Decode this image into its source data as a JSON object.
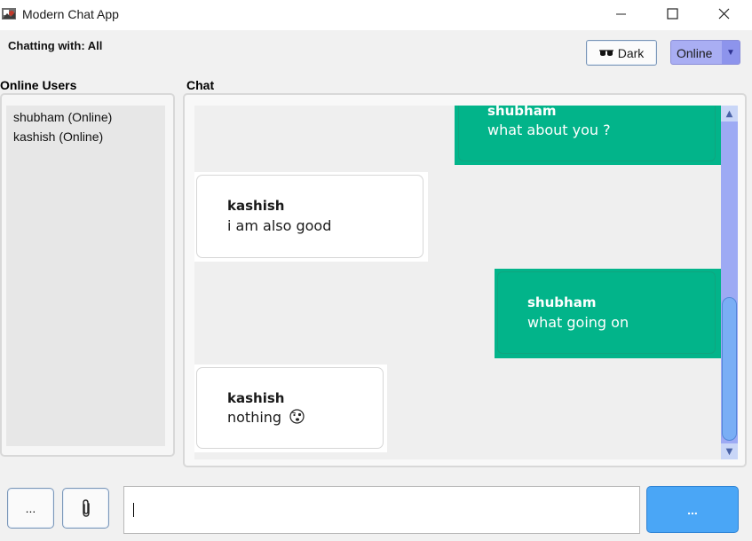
{
  "window": {
    "title": "Modern Chat App",
    "controls": {
      "minimize": "—",
      "maximize": "☐",
      "close": "✕"
    }
  },
  "header": {
    "chatting_with": "Chatting with: All",
    "theme_button": "Dark",
    "theme_icon": "sunglasses-icon",
    "status_select": {
      "value": "Online",
      "arrow": "▼"
    }
  },
  "users_panel": {
    "label": "Online Users",
    "users": [
      {
        "label": "shubham (Online)"
      },
      {
        "label": "kashish (Online)"
      }
    ]
  },
  "chat_panel": {
    "label": "Chat",
    "messages": [
      {
        "sender": "shubham",
        "text": "what about you ?",
        "direction": "outgoing"
      },
      {
        "sender": "kashish",
        "text": "i am also good",
        "direction": "incoming"
      },
      {
        "sender": "shubham",
        "text": "what going on",
        "direction": "outgoing"
      },
      {
        "sender": "kashish",
        "text": "nothing",
        "emoji": "confused-face-icon",
        "direction": "incoming"
      }
    ],
    "scroll": {
      "up": "▲",
      "down": "▼"
    }
  },
  "composer": {
    "emoji_button": "...",
    "attach_icon": "paperclip-icon",
    "input_value": "",
    "send_button": "..."
  },
  "colors": {
    "outgoing_bubble": "#02b48a",
    "incoming_bubble": "#ffffff",
    "send_button": "#4aa6f6",
    "status_select": "#a9aef3",
    "scrollbar_track": "#9daaf4"
  }
}
